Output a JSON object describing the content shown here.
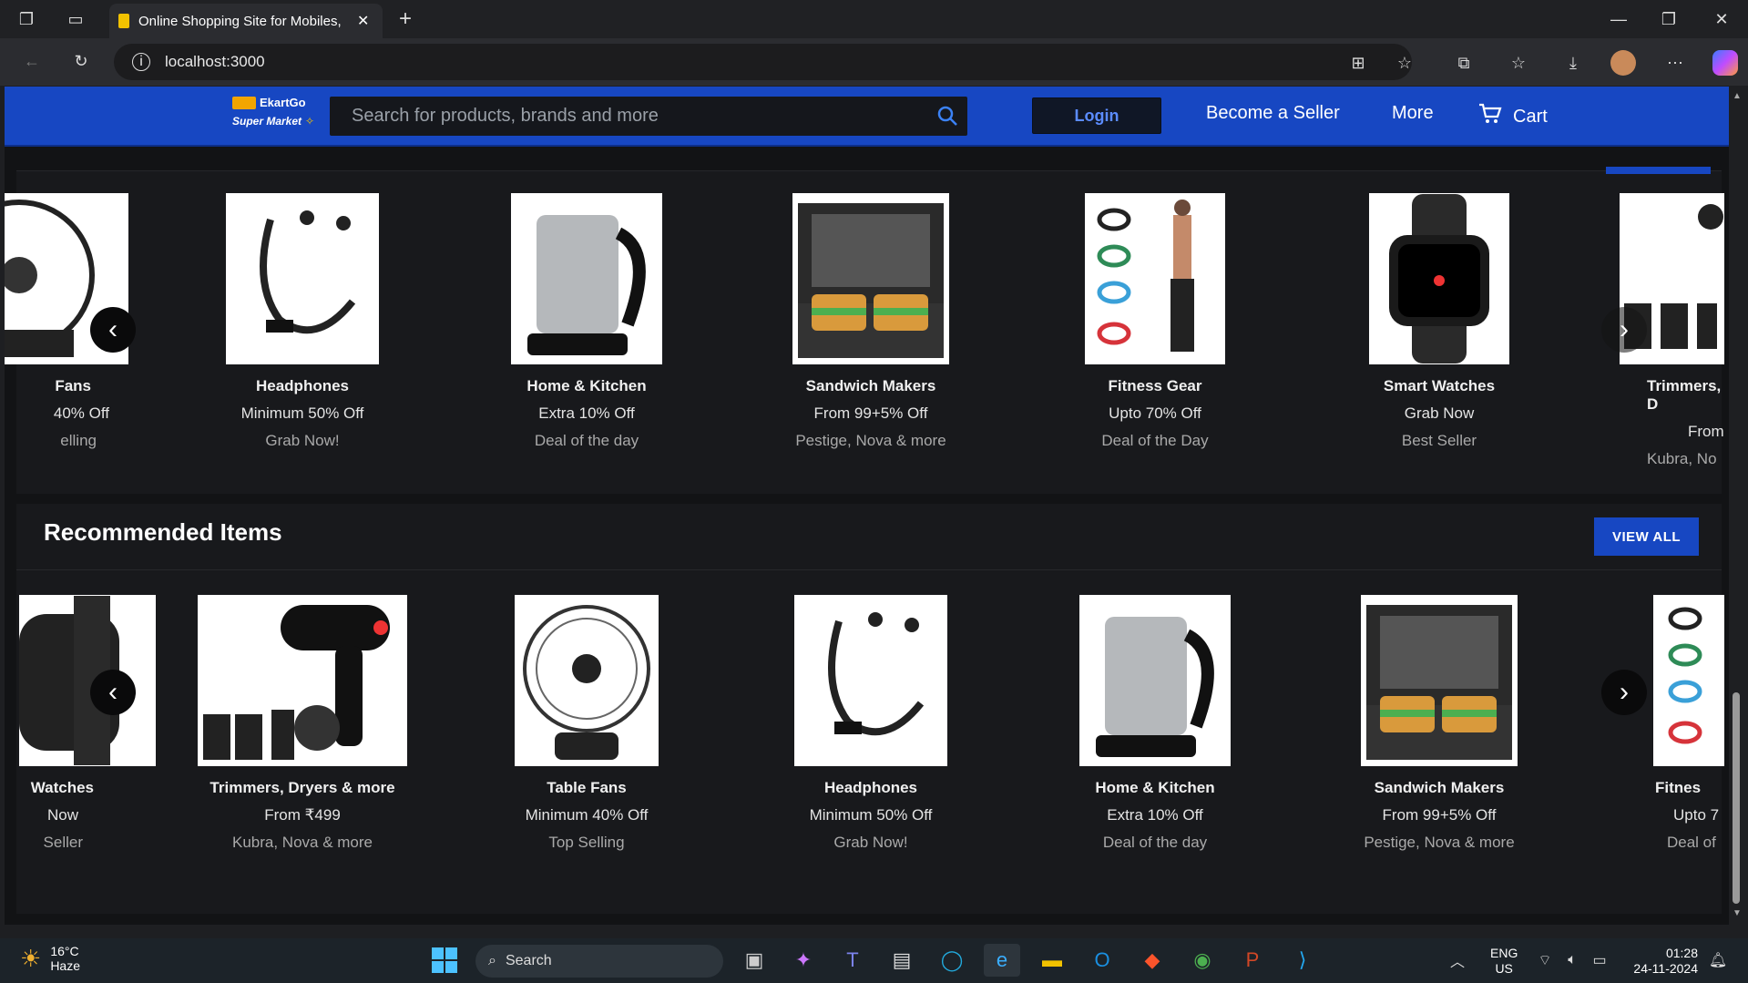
{
  "browser": {
    "tab_title": "Online Shopping Site for Mobiles,",
    "url": "localhost:3000"
  },
  "header": {
    "brand": "EkartGo",
    "brand_sub": "Super Market",
    "search_placeholder": "Search for products, brands and more",
    "login_label": "Login",
    "seller_label": "Become a Seller",
    "more_label": "More",
    "cart_label": "Cart"
  },
  "deals_row": [
    {
      "name": "Fans",
      "offer": "40% Off",
      "brand": "elling"
    },
    {
      "name": "Headphones",
      "offer": "Minimum 50% Off",
      "brand": "Grab Now!"
    },
    {
      "name": "Home & Kitchen",
      "offer": "Extra 10% Off",
      "brand": "Deal of the day"
    },
    {
      "name": "Sandwich Makers",
      "offer": "From 99+5% Off",
      "brand": "Pestige, Nova & more"
    },
    {
      "name": "Fitness Gear",
      "offer": "Upto 70% Off",
      "brand": "Deal of the Day"
    },
    {
      "name": "Smart Watches",
      "offer": "Grab Now",
      "brand": "Best Seller"
    },
    {
      "name": "Trimmers, D",
      "offer": "From",
      "brand": "Kubra, No"
    }
  ],
  "recommended": {
    "title": "Recommended Items",
    "view_all": "VIEW ALL",
    "items": [
      {
        "name": "Watches",
        "offer": "Now",
        "brand": "Seller"
      },
      {
        "name": "Trimmers, Dryers & more",
        "offer": "From ₹499",
        "brand": "Kubra, Nova & more"
      },
      {
        "name": "Table Fans",
        "offer": "Minimum 40% Off",
        "brand": "Top Selling"
      },
      {
        "name": "Headphones",
        "offer": "Minimum 50% Off",
        "brand": "Grab Now!"
      },
      {
        "name": "Home & Kitchen",
        "offer": "Extra 10% Off",
        "brand": "Deal of the day"
      },
      {
        "name": "Sandwich Makers",
        "offer": "From 99+5% Off",
        "brand": "Pestige, Nova & more"
      },
      {
        "name": "Fitnes",
        "offer": "Upto 7",
        "brand": "Deal of"
      }
    ]
  },
  "taskbar": {
    "weather_temp": "16°C",
    "weather_desc": "Haze",
    "search_label": "Search",
    "lang1": "ENG",
    "lang2": "US",
    "time": "01:28",
    "date": "24-11-2024"
  }
}
